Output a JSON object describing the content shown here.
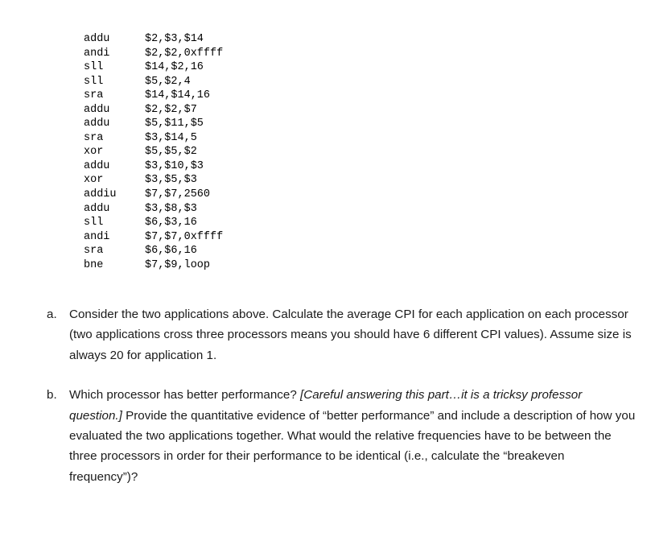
{
  "code_listing": {
    "name": "mips-assembly-listing",
    "lines": [
      {
        "op": "addu",
        "args": "$2,$3,$14"
      },
      {
        "op": "andi",
        "args": "$2,$2,0xffff"
      },
      {
        "op": "sll",
        "args": "$14,$2,16"
      },
      {
        "op": "sll",
        "args": "$5,$2,4"
      },
      {
        "op": "sra",
        "args": "$14,$14,16"
      },
      {
        "op": "addu",
        "args": "$2,$2,$7"
      },
      {
        "op": "addu",
        "args": "$5,$11,$5"
      },
      {
        "op": "sra",
        "args": "$3,$14,5"
      },
      {
        "op": "xor",
        "args": "$5,$5,$2"
      },
      {
        "op": "addu",
        "args": "$3,$10,$3"
      },
      {
        "op": "xor",
        "args": "$3,$5,$3"
      },
      {
        "op": "addiu",
        "args": "$7,$7,2560"
      },
      {
        "op": "addu",
        "args": "$3,$8,$3"
      },
      {
        "op": "sll",
        "args": "$6,$3,16"
      },
      {
        "op": "andi",
        "args": "$7,$7,0xffff"
      },
      {
        "op": "sra",
        "args": "$6,$6,16"
      },
      {
        "op": "bne",
        "args": "$7,$9,loop"
      }
    ]
  },
  "questions": [
    {
      "marker": "a.",
      "segments": [
        {
          "style": "normal",
          "text": "Consider the two applications above. Calculate the average CPI for each application on each processor (two applications cross three processors means you should have 6 different CPI values). Assume size is always 20 for application 1."
        }
      ]
    },
    {
      "marker": "b.",
      "segments": [
        {
          "style": "normal",
          "text": "Which processor has better performance? "
        },
        {
          "style": "italic",
          "text": "[Careful answering this part…it is a tricksy professor question.]"
        },
        {
          "style": "normal",
          "text": " Provide the quantitative evidence of “better performance” and include a description of how you evaluated the two applications together. What would the relative frequencies have to be between the three processors in order for their performance to be identical (i.e., calculate the “breakeven frequency”)?"
        }
      ]
    }
  ],
  "colors": {
    "page_background": "#ffffff",
    "code_text": "#000000",
    "body_text": "#1b1b1b"
  }
}
